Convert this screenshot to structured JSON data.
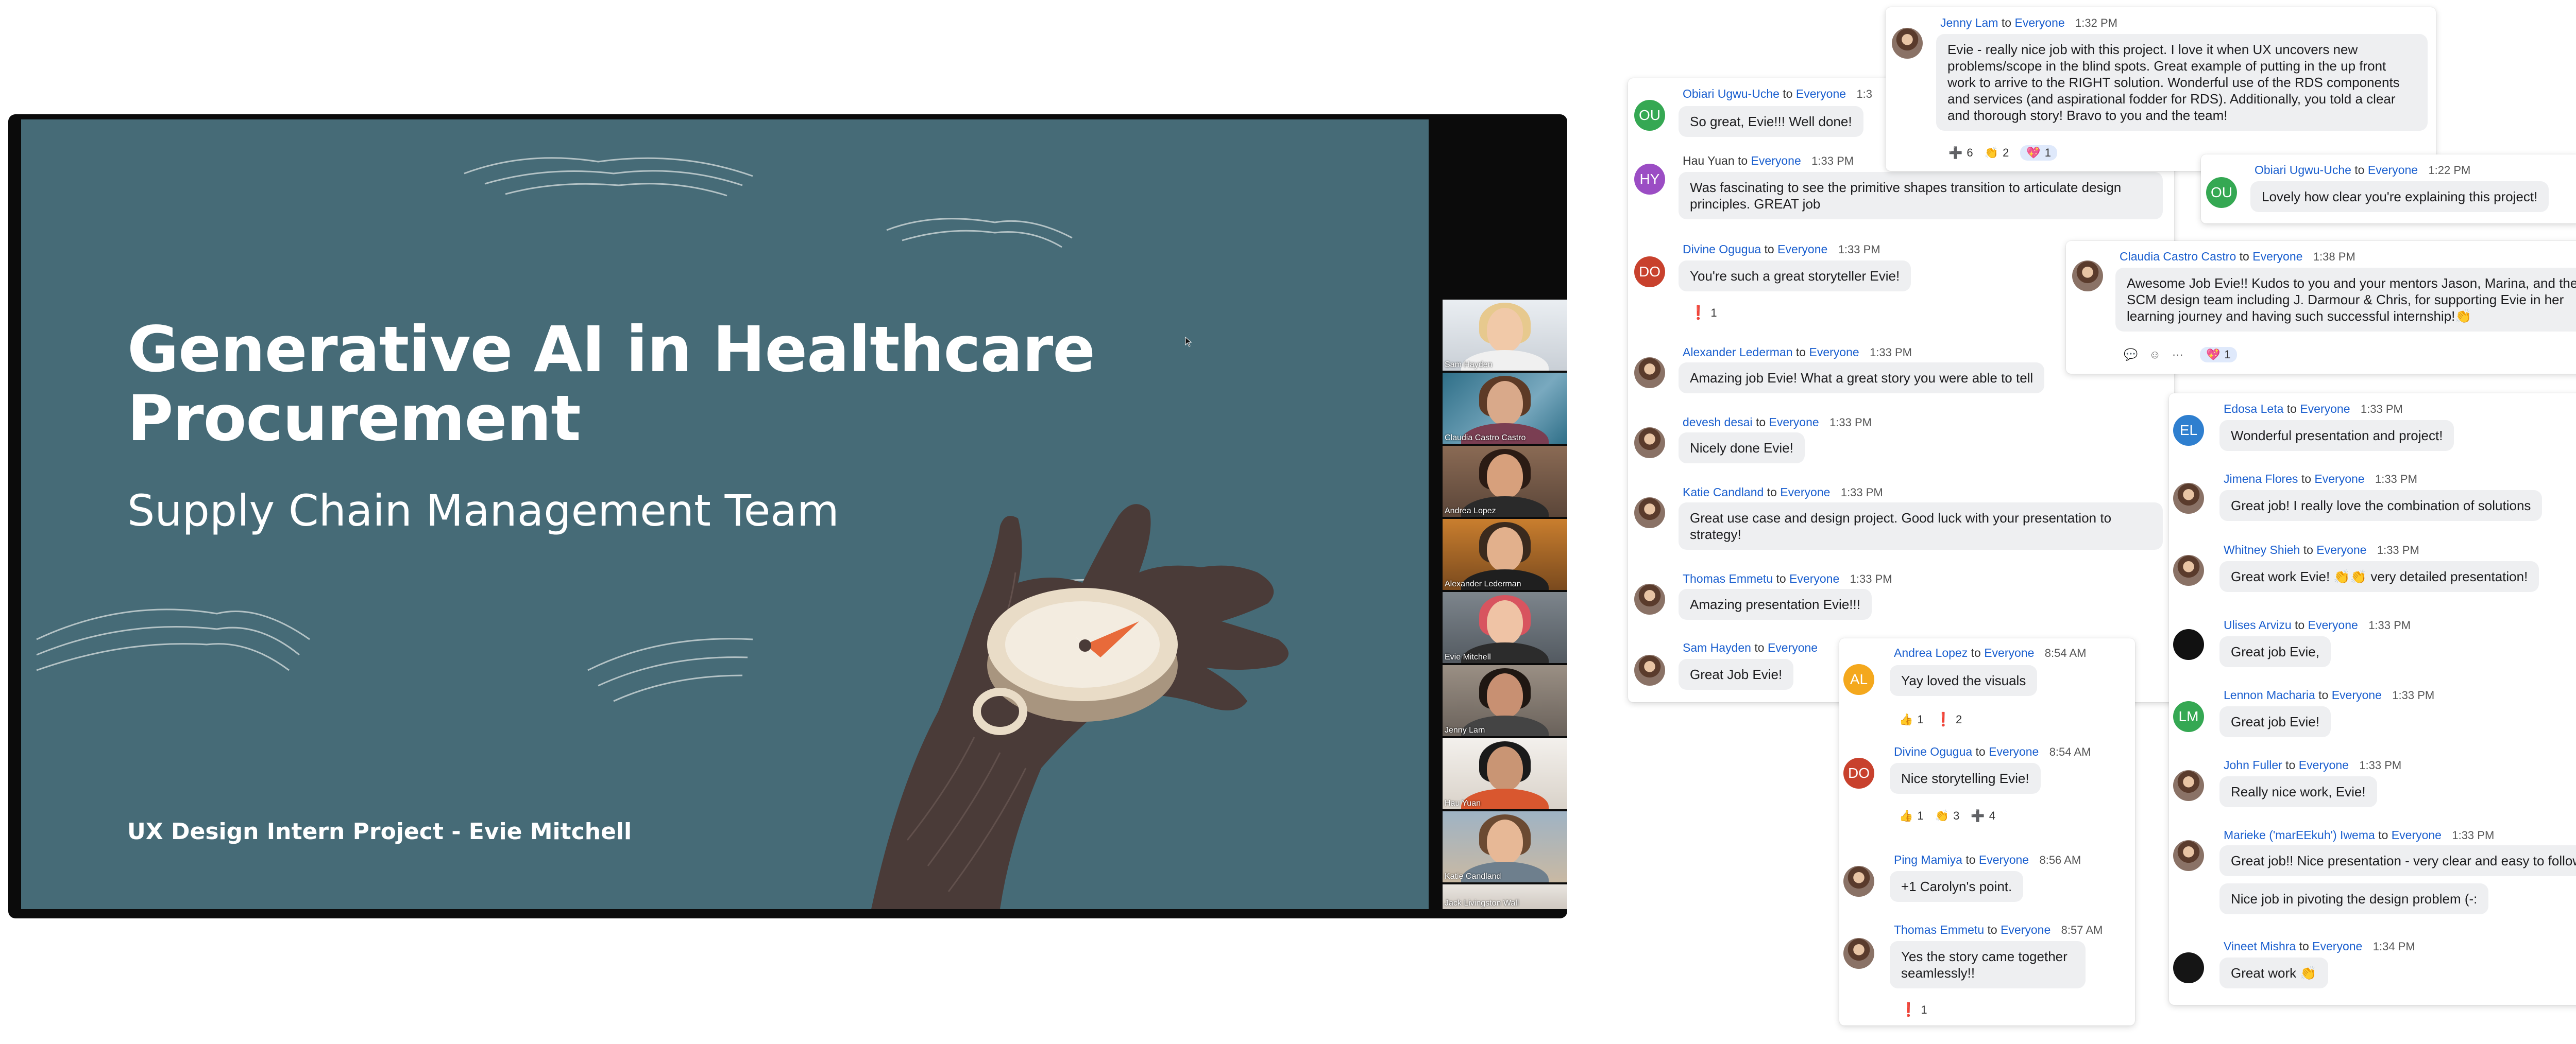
{
  "slide": {
    "title": "Generative AI in Healthcare Procurement",
    "subtitle": "Supply Chain Management Team",
    "footer": "UX Design Intern Project - Evie Mitchell"
  },
  "participants": [
    {
      "name": "Sam Hayden"
    },
    {
      "name": "Claudia Castro Castro"
    },
    {
      "name": "Andrea Lopez"
    },
    {
      "name": "Alexander Lederman"
    },
    {
      "name": "Evie Mitchell"
    },
    {
      "name": "Jenny Lam"
    },
    {
      "name": "Hau Yuan"
    },
    {
      "name": "Katie Candland"
    },
    {
      "name": "Jack Livingston Wall"
    }
  ],
  "chat": {
    "to_word": "to",
    "recipient": "Everyone",
    "card_left": [
      {
        "sender": "Obiari Ugwu-Uche",
        "time": "1:3",
        "initials": "OU",
        "color": "#35a853",
        "text": "So great, Evie!!! Well done!"
      },
      {
        "sender": "Hau Yuan",
        "time": "1:33 PM",
        "initials": "HY",
        "color": "#9b4dc4",
        "text": "Was fascinating to see the primitive shapes transition to articulate design principles. GREAT job"
      },
      {
        "sender": "Divine Ogugua",
        "time": "1:33 PM",
        "initials": "DO",
        "color": "#c8412d",
        "text": "You're such a great storyteller Evie!",
        "reactions": [
          {
            "glyph": "❗",
            "count": "1"
          }
        ]
      },
      {
        "sender": "Alexander Lederman",
        "time": "1:33 PM",
        "text": "Amazing job Evie! What a great story you were able to tell"
      },
      {
        "sender": "devesh desai",
        "time": "1:33 PM",
        "text": "Nicely done Evie!"
      },
      {
        "sender": "Katie Candland",
        "time": "1:33 PM",
        "text": "Great use case and design project. Good luck with your presentation to strategy!"
      },
      {
        "sender": "Thomas Emmetu",
        "time": "1:33 PM",
        "text": "Amazing presentation Evie!!!"
      },
      {
        "sender": "Sam Hayden",
        "time": "",
        "text": "Great Job Evie!"
      }
    ],
    "jenny": {
      "sender": "Jenny Lam",
      "time": "1:32 PM",
      "text": "Evie - really nice job with this project. I love it when UX uncovers new problems/scope in the blind spots. Great example of putting in the up front work to arrive to the RIGHT solution. Wonderful use of the RDS components and services (and aspirational fodder for RDS). Additionally, you told a clear and thorough story! Bravo to you and the team!",
      "reactions": [
        {
          "glyph": "➕",
          "count": "6"
        },
        {
          "glyph": "👏",
          "count": "2"
        },
        {
          "glyph": "💖",
          "count": "1"
        }
      ]
    },
    "obiari2": {
      "sender": "Obiari Ugwu-Uche",
      "time": "1:22 PM",
      "initials": "OU",
      "color": "#35a853",
      "text": "Lovely how clear you're explaining this project!"
    },
    "claudia": {
      "sender": "Claudia Castro Castro",
      "time": "1:38 PM",
      "text": "Awesome Job Evie!! Kudos to you and your mentors Jason, Marina, and the full SCM design team including J. Darmour & Chris, for supporting Evie in her learning journey and having such successful internship!👏",
      "tools": [
        "💬",
        "☺",
        "···"
      ],
      "reactions": [
        {
          "glyph": "💖",
          "count": "1"
        }
      ]
    },
    "card_middle": [
      {
        "sender": "Andrea Lopez",
        "time": "8:54 AM",
        "initials": "AL",
        "color": "#f4a81d",
        "text": "Yay loved the visuals",
        "reactions": [
          {
            "glyph": "👍",
            "count": "1"
          },
          {
            "glyph": "❗",
            "count": "2"
          }
        ]
      },
      {
        "sender": "Divine Ogugua",
        "time": "8:54 AM",
        "initials": "DO",
        "color": "#c8412d",
        "text": "Nice storytelling Evie!",
        "reactions": [
          {
            "glyph": "👍",
            "count": "1"
          },
          {
            "glyph": "👏",
            "count": "3"
          },
          {
            "glyph": "➕",
            "count": "4"
          }
        ]
      },
      {
        "sender": "Ping Mamiya",
        "time": "8:56 AM",
        "text": "+1 Carolyn's point."
      },
      {
        "sender": "Thomas Emmetu",
        "time": "8:57 AM",
        "text": "Yes the story came together seamlessly!!",
        "reactions": [
          {
            "glyph": "❗",
            "count": "1"
          }
        ]
      }
    ],
    "card_right": [
      {
        "sender": "Edosa Leta",
        "time": "1:33 PM",
        "initials": "EL",
        "color": "#2f7fcf",
        "text": "Wonderful presentation and project!"
      },
      {
        "sender": "Jimena Flores",
        "time": "1:33 PM",
        "text": "Great job! I really love the combination of solutions"
      },
      {
        "sender": "Whitney Shieh",
        "time": "1:33 PM",
        "text": "Great work Evie! 👏👏 very detailed presentation!"
      },
      {
        "sender": "Ulises Arvizu",
        "time": "1:33 PM",
        "text": "Great job Evie,"
      },
      {
        "sender": "Lennon Macharia",
        "time": "1:33 PM",
        "initials": "LM",
        "color": "#35a853",
        "text": "Great job Evie!"
      },
      {
        "sender": "John Fuller",
        "time": "1:33 PM",
        "text": "Really nice work, Evie!"
      },
      {
        "sender": "Marieke ('marEEkuh') Iwema",
        "time": "1:33 PM",
        "text": "Great job!! Nice presentation - very clear and easy to follow (-:",
        "text2": "Nice job in pivoting the design problem (-:"
      },
      {
        "sender": "Vineet Mishra",
        "time": "1:34 PM",
        "text": "Great work 👏"
      }
    ]
  }
}
